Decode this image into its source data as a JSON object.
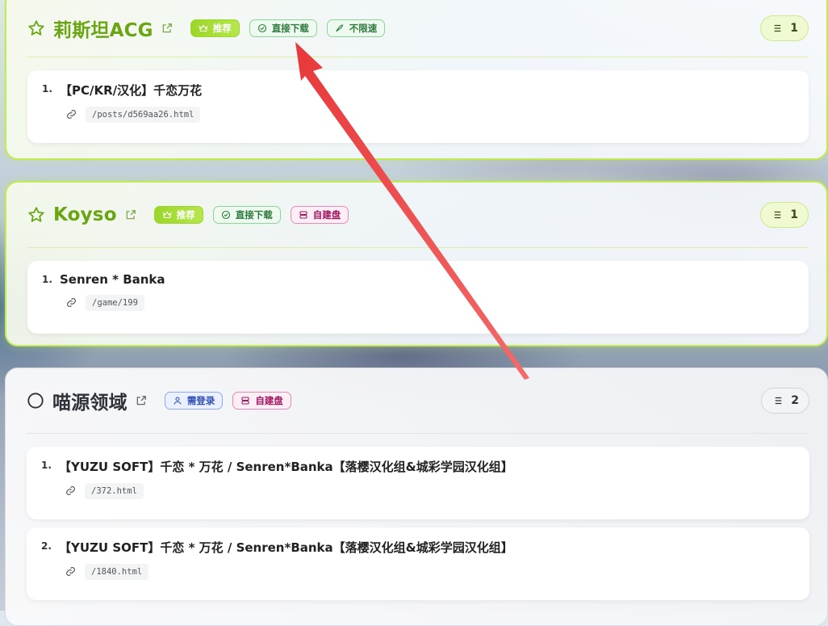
{
  "colors": {
    "accent_green": "#6aa514",
    "card_border_green": "#c3ea52",
    "arrow_red": "#ee4444"
  },
  "cards": [
    {
      "title": "莉斯坦ACG",
      "badges": [
        {
          "label": "推荐",
          "icon": "crown-icon"
        },
        {
          "label": "直接下载",
          "icon": "check-circle-icon"
        },
        {
          "label": "不限速",
          "icon": "rocket-icon"
        }
      ],
      "count": "1",
      "items": [
        {
          "num": "1.",
          "title": "【PC/KR/汉化】千恋万花",
          "path": "/posts/d569aa26.html"
        }
      ]
    },
    {
      "title": "Koyso",
      "badges": [
        {
          "label": "推荐",
          "icon": "crown-icon"
        },
        {
          "label": "直接下载",
          "icon": "check-circle-icon"
        },
        {
          "label": "自建盘",
          "icon": "server-icon"
        }
      ],
      "count": "1",
      "items": [
        {
          "num": "1.",
          "title": "Senren * Banka",
          "path": "/game/199"
        }
      ]
    },
    {
      "title": "喵源领域",
      "badges": [
        {
          "label": "需登录",
          "icon": "user-icon"
        },
        {
          "label": "自建盘",
          "icon": "server-icon"
        }
      ],
      "count": "2",
      "items": [
        {
          "num": "1.",
          "title": "【YUZU SOFT】千恋 * 万花 / Senren*Banka【落樱汉化组&城彩学园汉化组】",
          "path": "/372.html"
        },
        {
          "num": "2.",
          "title": "【YUZU SOFT】千恋 * 万花 / Senren*Banka【落樱汉化组&城彩学园汉化组】",
          "path": "/1840.html"
        }
      ]
    }
  ]
}
